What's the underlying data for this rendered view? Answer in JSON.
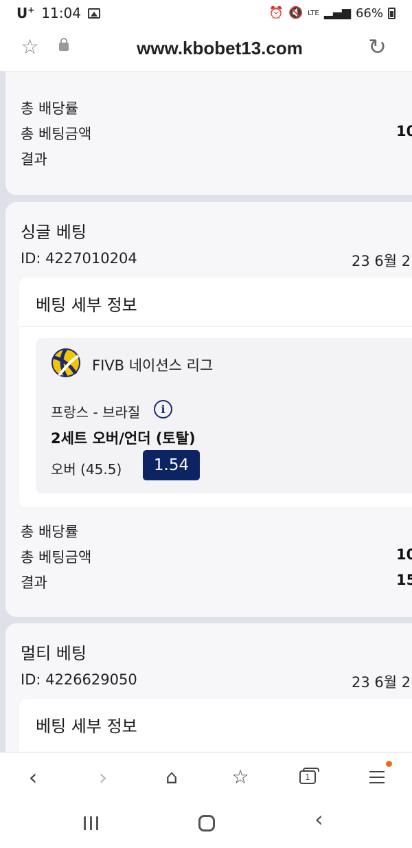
{
  "status_bar": {
    "carrier": "U",
    "carrier_sup": "+",
    "time": "11:04",
    "battery": "66%",
    "network": "LTE"
  },
  "browser": {
    "url": "www.kbobet13.com"
  },
  "card_top": {
    "rows": [
      {
        "label": "총 배당률",
        "value": ""
      },
      {
        "label": "총 베팅금액",
        "value": "10"
      },
      {
        "label": "결과",
        "value": ""
      }
    ]
  },
  "card_single": {
    "title": "싱글 베팅",
    "id": "ID: 4227010204",
    "date": "23 6월 2",
    "detail_title": "베팅 세부 정보",
    "league": "FIVB 네이션스 리그",
    "match": "프랑스 - 브라질",
    "market": "2세트 오버/언더 (토탈)",
    "selection": "오버 (45.5)",
    "odds": "1.54",
    "rows": [
      {
        "label": "총 배당률",
        "value": ""
      },
      {
        "label": "총 베팅금액",
        "value": "10"
      },
      {
        "label": "결과",
        "value": "15"
      }
    ]
  },
  "card_multi": {
    "title": "멀티 베팅",
    "id": "ID: 4226629050",
    "date": "23 6월 2",
    "detail_title": "베팅 세부 정보"
  },
  "icons": {
    "league": "volleyball-icon",
    "info": "info-icon",
    "favorite": "star-icon",
    "secure": "lock-icon",
    "reload": "reload-icon"
  },
  "colors": {
    "odds_bg": "#0d2462",
    "page_bg": "#dfe1ea",
    "notification": "#f06a1b"
  }
}
